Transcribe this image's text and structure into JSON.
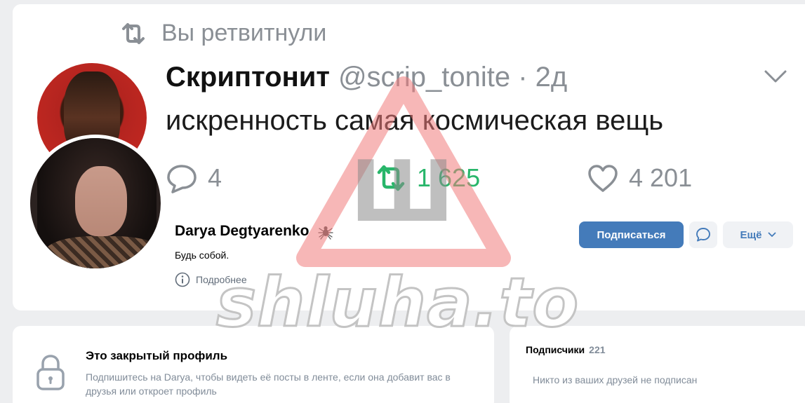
{
  "tweet": {
    "retweet_label": "Вы ретвитнули",
    "author_name": "Скриптонит",
    "author_handle_time": "@scrip_tonite · 2д",
    "text": "искренность самая космическая вещь",
    "replies": "4",
    "retweets": "1 625",
    "likes": "4 201"
  },
  "profile": {
    "name": "Darya Degtyarenko",
    "status": "Будь собой.",
    "more_link": "Подробнее",
    "subscribe_label": "Подписаться",
    "more_label": "Ещё"
  },
  "private": {
    "title": "Это закрытый профиль",
    "text": "Подпишитесь на Darya, чтобы видеть её посты в ленте, если она добавит вас в друзья или откроет профиль"
  },
  "followers": {
    "title": "Подписчики",
    "count": "221",
    "empty_text": "Никто из ваших друзей не подписан"
  },
  "watermark": {
    "text": "shluha.to",
    "letter": "Ш"
  },
  "colors": {
    "accent": "#447bba",
    "retweet_green": "#28b66a",
    "watermark_red": "#f07c7c"
  }
}
